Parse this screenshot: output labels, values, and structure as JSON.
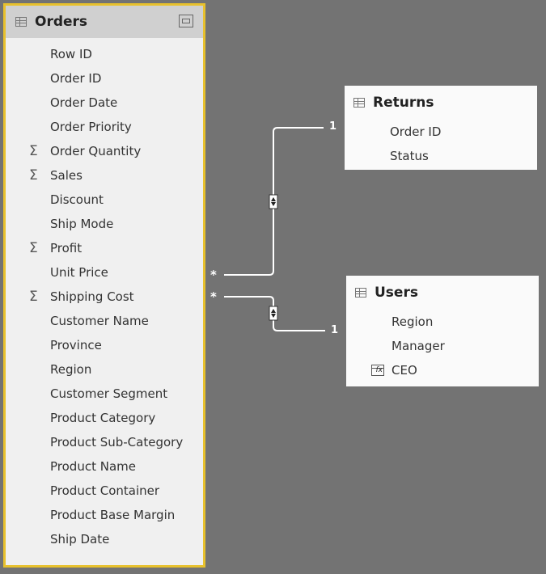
{
  "orders": {
    "title": "Orders",
    "fields": [
      {
        "label": "Row ID",
        "sigma": false
      },
      {
        "label": "Order ID",
        "sigma": false
      },
      {
        "label": "Order Date",
        "sigma": false
      },
      {
        "label": "Order Priority",
        "sigma": false
      },
      {
        "label": "Order Quantity",
        "sigma": true
      },
      {
        "label": "Sales",
        "sigma": true
      },
      {
        "label": "Discount",
        "sigma": false
      },
      {
        "label": "Ship Mode",
        "sigma": false
      },
      {
        "label": "Profit",
        "sigma": true
      },
      {
        "label": "Unit Price",
        "sigma": false
      },
      {
        "label": "Shipping Cost",
        "sigma": true
      },
      {
        "label": "Customer Name",
        "sigma": false
      },
      {
        "label": "Province",
        "sigma": false
      },
      {
        "label": "Region",
        "sigma": false
      },
      {
        "label": "Customer Segment",
        "sigma": false
      },
      {
        "label": "Product Category",
        "sigma": false
      },
      {
        "label": "Product Sub-Category",
        "sigma": false
      },
      {
        "label": "Product Name",
        "sigma": false
      },
      {
        "label": "Product Container",
        "sigma": false
      },
      {
        "label": "Product Base Margin",
        "sigma": false
      },
      {
        "label": "Ship Date",
        "sigma": false
      }
    ]
  },
  "returns": {
    "title": "Returns",
    "fields": [
      "Order ID",
      "Status"
    ]
  },
  "users": {
    "title": "Users",
    "fields": [
      "Region",
      "Manager",
      "CEO"
    ]
  },
  "relationships": {
    "returns": {
      "many": "*",
      "one": "1"
    },
    "users": {
      "many": "*",
      "one": "1"
    }
  },
  "sigma_glyph": "Σ",
  "calc_glyph": "fx",
  "colors": {
    "canvas": "#737373",
    "selected_border": "#e8c12d",
    "header": "#d0d0d0"
  }
}
